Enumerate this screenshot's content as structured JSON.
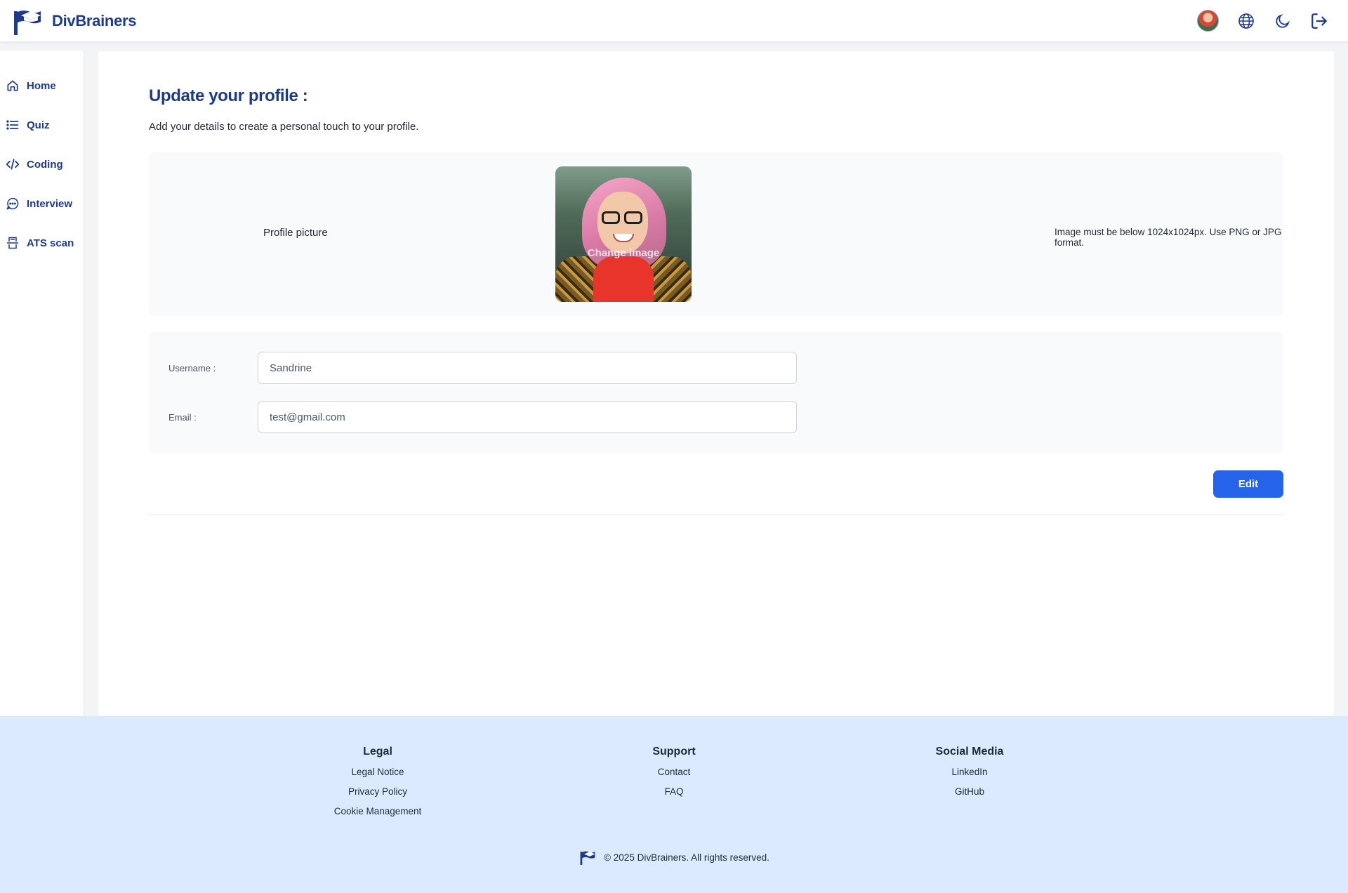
{
  "app": {
    "brand": "DivBrainers"
  },
  "sidebar": {
    "items": [
      {
        "label": "Home",
        "icon": "home-icon"
      },
      {
        "label": "Quiz",
        "icon": "list-icon"
      },
      {
        "label": "Coding",
        "icon": "code-icon"
      },
      {
        "label": "Interview",
        "icon": "chat-icon"
      },
      {
        "label": "ATS scan",
        "icon": "scan-icon"
      }
    ]
  },
  "header": {
    "icons": [
      "avatar",
      "globe-icon",
      "moon-icon",
      "logout-icon"
    ]
  },
  "main": {
    "title": "Update your profile :",
    "subtitle": "Add your details to create a personal touch to your profile.",
    "picture": {
      "label": "Profile picture",
      "overlay": "Change image",
      "hint": "Image must be below 1024x1024px. Use PNG or JPG format."
    },
    "form": {
      "username_label": "Username :",
      "username_value": "Sandrine",
      "email_label": "Email :",
      "email_value": "test@gmail.com"
    },
    "edit_label": "Edit"
  },
  "footer": {
    "columns": [
      {
        "title": "Legal",
        "links": [
          "Legal Notice",
          "Privacy Policy",
          "Cookie Management"
        ]
      },
      {
        "title": "Support",
        "links": [
          "Contact",
          "FAQ"
        ]
      },
      {
        "title": "Social Media",
        "links": [
          "LinkedIn",
          "GitHub"
        ]
      }
    ],
    "copyright": "© 2025 DivBrainers. All rights reserved."
  },
  "colors": {
    "brand": "#1e3a8a",
    "accent": "#2563eb",
    "footer_bg": "#dbeafe",
    "panel_bg": "#f8fafc"
  }
}
